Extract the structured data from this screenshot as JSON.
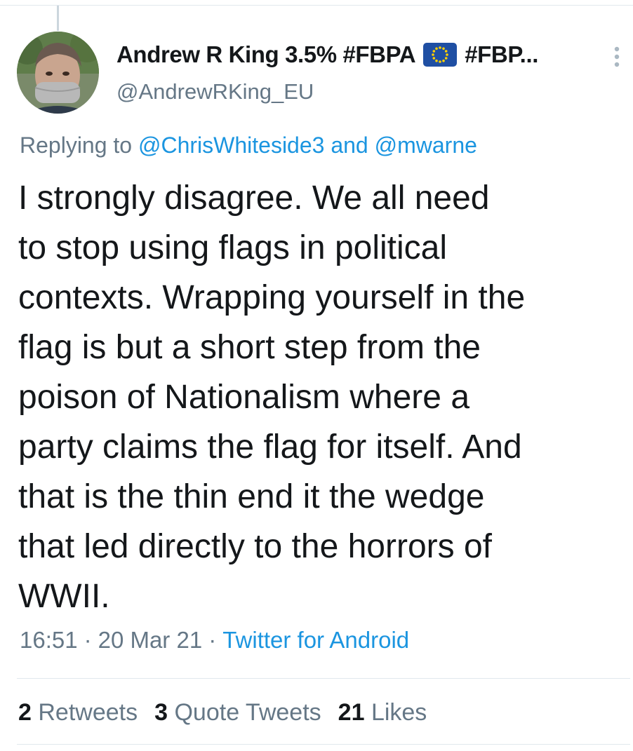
{
  "author": {
    "display_name": "Andrew R King 3.5% #FBPA",
    "display_name_suffix": "#FBP...",
    "flag_icon": "eu-flag-emoji",
    "handle": "@AndrewRKing_EU"
  },
  "reply": {
    "prefix": "Replying to",
    "user1": "@ChrisWhiteside3",
    "conjunction": "and",
    "user2": "@mwarne"
  },
  "tweet": {
    "lines": [
      "I strongly disagree. We all need",
      "to stop using flags in political",
      "contexts. Wrapping yourself in the",
      "flag is but a short step from the",
      "poison of Nationalism where a",
      "party claims the flag for itself. And",
      "that is the thin end it the wedge",
      "that led directly to the horrors of",
      "WWII."
    ]
  },
  "meta": {
    "time": "16:51",
    "separator": "·",
    "date": "20 Mar 21",
    "source": "Twitter for Android"
  },
  "stats": {
    "retweets_count": "2",
    "retweets_label": "Retweets",
    "quotes_count": "3",
    "quotes_label": "Quote Tweets",
    "likes_count": "21",
    "likes_label": "Likes"
  },
  "colors": {
    "link": "#1b95e0",
    "secondary_text": "#657786",
    "primary_text": "#14171a",
    "divider": "#e1e8ed"
  }
}
